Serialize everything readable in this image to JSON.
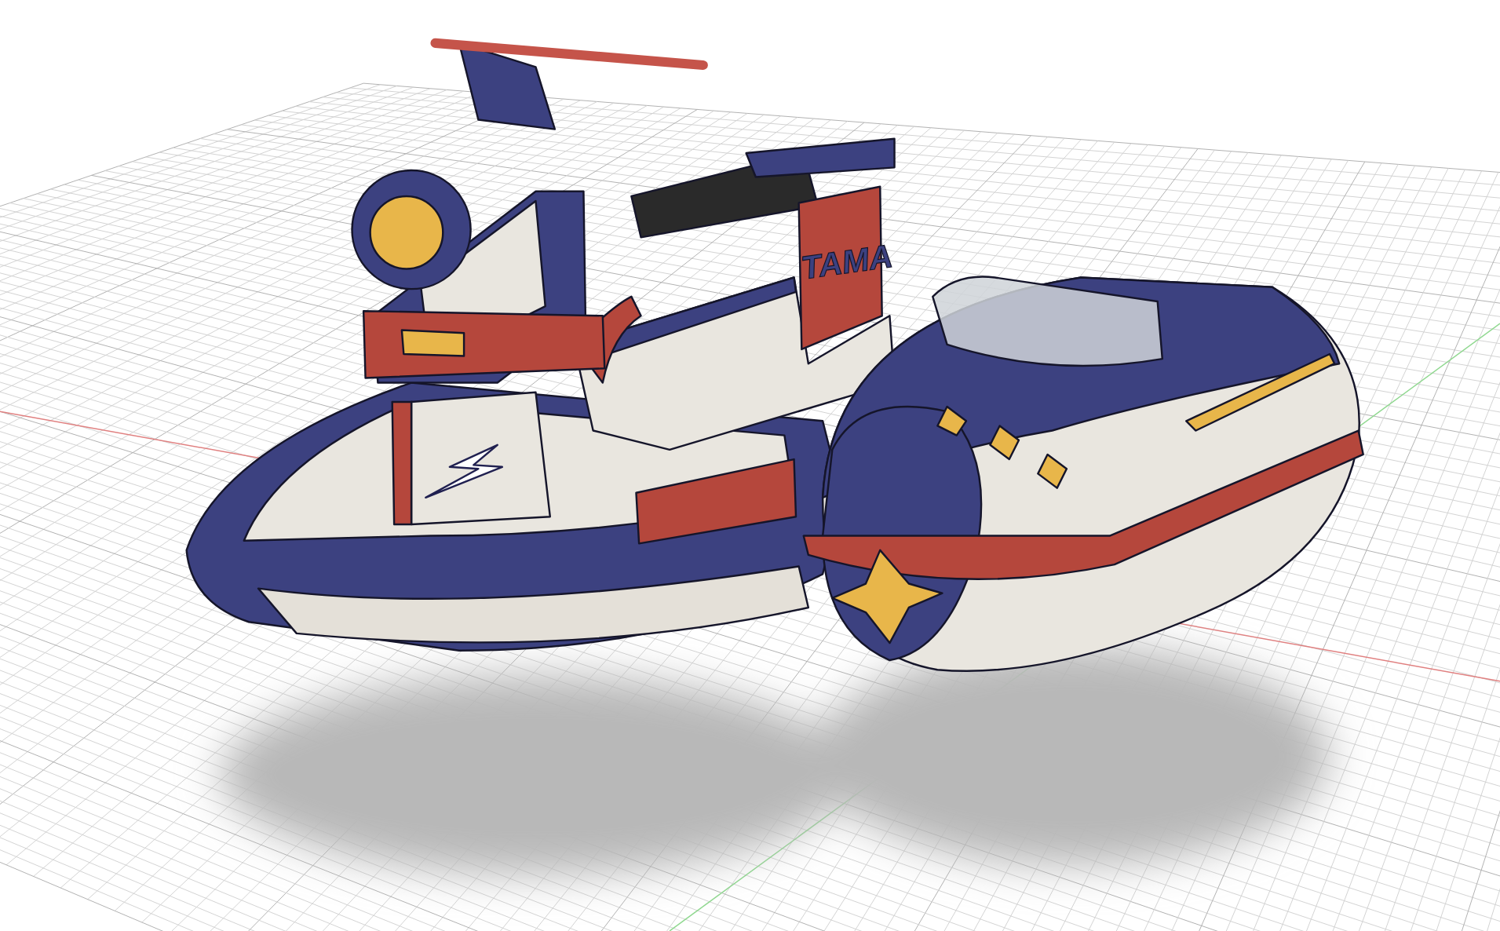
{
  "viewport": {
    "model": {
      "decal_text": "TAMA"
    }
  }
}
